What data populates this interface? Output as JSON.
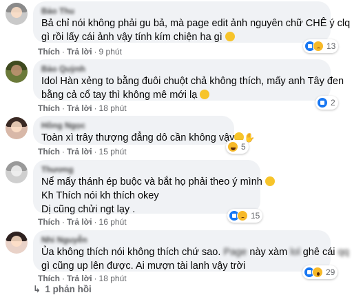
{
  "action_labels": {
    "like": "Thích",
    "reply": "Trả lời",
    "separator": "·"
  },
  "comments": [
    {
      "author": "Bảo Thu",
      "lines": [
        "Bả chỉ nói không phải gu bả, mà page edit ảnh nguyên chữ CHÊ ý clq",
        "gì rồi lấy cái ảnh vậy tính kím chiện ha gì"
      ],
      "trailing_emoji": "confused-face-emoji",
      "time": "9 phút",
      "reactions": [
        "like",
        "sad"
      ],
      "reaction_count": "13"
    },
    {
      "author": "Bảo Quỳnh",
      "lines": [
        "Idol Hàn xẻng to bằng đuôi chuột chả không thích, mấy anh Tây đen",
        "bằng cả cổ tay thì không mê mới lạ"
      ],
      "trailing_emoji": "pacman-emoji",
      "time": "18 phút",
      "reactions": [
        "like"
      ],
      "reaction_count": "2"
    },
    {
      "author": "Hồng Ngọc",
      "lines": [
        "Toàn xì trây thượng đẳng dô cần không vậy"
      ],
      "trailing_emoji": "confused-hand-emoji",
      "time": "15 phút",
      "reactions": [
        "haha"
      ],
      "reaction_count": "5"
    },
    {
      "author": "Thương",
      "lines": [
        "Nể mấy thánh ép buộc và bắt họ phải theo ý mình",
        "Kh Thích nói kh thích okey",
        "Dị cũng chửi ngt lạy ."
      ],
      "trailing_emoji": "smile-emoji",
      "time": "16 phút",
      "reactions": [
        "like",
        "sad"
      ],
      "reaction_count": "15"
    },
    {
      "author": "Nhi Nguyễn",
      "line1_a": "Ủa không thích nói không thích chứ sao.",
      "line1_blur": "Page",
      "line1_b": "này xàm",
      "line1_blur2": "lol",
      "line1_c": "ghê cái",
      "line1_blur3": "qq",
      "line2": "gì cũng up lên được. Ai mượn tài lanh vậy trời",
      "time": "18 phút",
      "reactions": [
        "like",
        "wow"
      ],
      "reaction_count": "29"
    }
  ],
  "view_replies": "1 phản hồi",
  "colors": {
    "bubble": "#f0f2f5",
    "meta": "#65676b",
    "like_blue": "#1877f2",
    "emoji_yellow": "#f7b928"
  }
}
